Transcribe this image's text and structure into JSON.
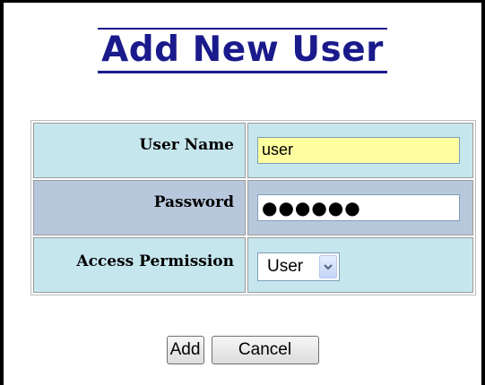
{
  "page": {
    "title": "Add New User"
  },
  "form": {
    "username_label": "User Name",
    "username_value": "user",
    "password_label": "Password",
    "password_mask": "●●●●●●",
    "permission_label": "Access Permission",
    "permission_selected": "User"
  },
  "buttons": {
    "add_label": "Add",
    "cancel_label": "Cancel"
  },
  "colors": {
    "title": "#1a1a8c",
    "row_light": "#c6e6ee",
    "row_dark": "#b8c8dc",
    "username_field_bg": "#ffffa0"
  },
  "icons": {
    "dropdown": "chevron-down-icon"
  }
}
